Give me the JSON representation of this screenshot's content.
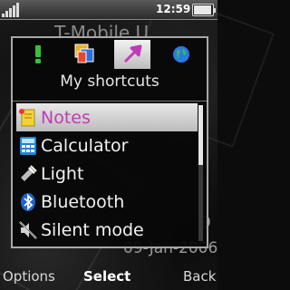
{
  "statusbar": {
    "time": "12:59",
    "battery_level": 0.95
  },
  "standby": {
    "operator": "T-Mobile U",
    "time_fragment": "9",
    "date": "09-Jan-2006"
  },
  "popup": {
    "title": "My shortcuts",
    "tabs": [
      {
        "icon": "exclamation-icon"
      },
      {
        "icon": "overlapping-windows-icon"
      },
      {
        "icon": "arrow-up-right-icon",
        "active": true
      },
      {
        "icon": "globe-icon"
      }
    ],
    "items": [
      {
        "label": "Notes",
        "icon": "notes-icon",
        "selected": true
      },
      {
        "label": "Calculator",
        "icon": "calculator-icon"
      },
      {
        "label": "Light",
        "icon": "flashlight-icon"
      },
      {
        "label": "Bluetooth",
        "icon": "bluetooth-icon"
      },
      {
        "label": "Silent mode",
        "icon": "silent-mode-icon"
      }
    ],
    "scroll_position": 0.0
  },
  "softkeys": {
    "left": "Options",
    "center": "Select",
    "right": "Back"
  },
  "colors": {
    "selected_text": "#c23ab8",
    "highlight": "#d8d8d8"
  }
}
